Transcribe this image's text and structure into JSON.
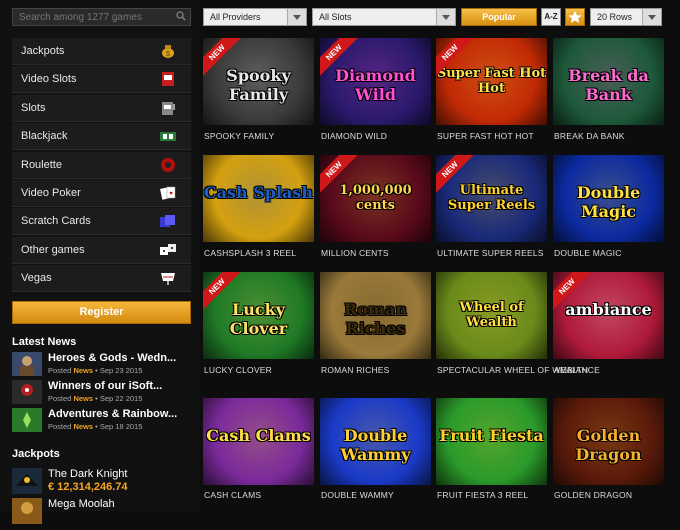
{
  "search": {
    "placeholder": "Search among 1277 games"
  },
  "sidebar": {
    "categories": [
      {
        "label": "Jackpots",
        "icon": "money-bag-icon"
      },
      {
        "label": "Video Slots",
        "icon": "video-slot-machine-icon"
      },
      {
        "label": "Slots",
        "icon": "slot-machine-icon"
      },
      {
        "label": "Blackjack",
        "icon": "blackjack-table-icon"
      },
      {
        "label": "Roulette",
        "icon": "roulette-wheel-icon"
      },
      {
        "label": "Video Poker",
        "icon": "playing-cards-icon"
      },
      {
        "label": "Scratch Cards",
        "icon": "scratch-cards-icon"
      },
      {
        "label": "Other games",
        "icon": "dice-icon"
      },
      {
        "label": "Vegas",
        "icon": "vegas-sign-icon"
      }
    ],
    "register_label": "Register",
    "latest_news_title": "Latest News",
    "news": [
      {
        "title": "Heroes & Gods - Wedn...",
        "posted": "Posted",
        "tag": "News",
        "date": "• Sep 23 2015"
      },
      {
        "title": "Winners of our iSoft...",
        "posted": "Posted",
        "tag": "News",
        "date": "• Sep 22 2015"
      },
      {
        "title": "Adventures & Rainbow...",
        "posted": "Posted",
        "tag": "News",
        "date": "• Sep 18 2015"
      }
    ],
    "jackpots_title": "Jackpots",
    "jackpots": [
      {
        "name": "The Dark Knight",
        "amount": "€ 12,314,246.74"
      },
      {
        "name": "Mega Moolah",
        "amount": ""
      }
    ]
  },
  "filters": {
    "providers": "All Providers",
    "type": "All Slots",
    "popular": "Popular",
    "az": "A-Z",
    "rows": "20 Rows"
  },
  "colors": {
    "accent": "#f0a020",
    "new_ribbon": "#d01818",
    "background": "#0d0d0d"
  },
  "new_label": "NEW",
  "games": [
    {
      "name": "SPOOKY FAMILY",
      "logo": "Spooky Family",
      "new": true,
      "bg": "#3a3a3a",
      "fg": "#e8e8e8"
    },
    {
      "name": "DIAMOND WILD",
      "logo": "Diamond Wild",
      "new": true,
      "bg": "#2b1a6e",
      "fg": "#ff4fd8"
    },
    {
      "name": "SUPER FAST HOT HOT",
      "logo": "Super Fast Hot Hot",
      "new": true,
      "bg": "#c22a05",
      "fg": "#ffe14a"
    },
    {
      "name": "BREAK DA BANK",
      "logo": "Break da Bank",
      "new": false,
      "bg": "#1d5a3a",
      "fg": "#ff6ad0"
    },
    {
      "name": "CASHSPLASH 3 REEL",
      "logo": "Cash Splash",
      "new": false,
      "bg": "#d4a010",
      "fg": "#1a5fc8"
    },
    {
      "name": "MILLION CENTS",
      "logo": "1,000,000 cents",
      "new": true,
      "bg": "#5a0a1a",
      "fg": "#ffd54a"
    },
    {
      "name": "ULTIMATE SUPER REELS",
      "logo": "Ultimate Super Reels",
      "new": true,
      "bg": "#1a2a7a",
      "fg": "#ffd230"
    },
    {
      "name": "DOUBLE MAGIC",
      "logo": "Double Magic",
      "new": false,
      "bg": "#0b2aa0",
      "fg": "#ffe040"
    },
    {
      "name": "LUCKY CLOVER",
      "logo": "Lucky Clover",
      "new": true,
      "bg": "#1f7a26",
      "fg": "#ffe066"
    },
    {
      "name": "ROMAN RICHES",
      "logo": "Roman Riches",
      "new": false,
      "bg": "#9a7a3a",
      "fg": "#3a2a10"
    },
    {
      "name": "SPECTACULAR WHEEL OF WEALTH",
      "logo": "Wheel of Wealth",
      "new": false,
      "bg": "#6a8a1a",
      "fg": "#ffe040"
    },
    {
      "name": "AMBIANCE",
      "logo": "ambiance",
      "new": true,
      "bg": "#b01a3a",
      "fg": "#ffffff"
    },
    {
      "name": "CASH CLAMS",
      "logo": "Cash Clams",
      "new": false,
      "bg": "#7a2a9a",
      "fg": "#ffe040"
    },
    {
      "name": "DOUBLE WAMMY",
      "logo": "Double Wammy",
      "new": false,
      "bg": "#1a3ac8",
      "fg": "#ffd030"
    },
    {
      "name": "FRUIT FIESTA 3 REEL",
      "logo": "Fruit Fiesta",
      "new": false,
      "bg": "#2a9a2a",
      "fg": "#ffd030"
    },
    {
      "name": "GOLDEN DRAGON",
      "logo": "Golden Dragon",
      "new": false,
      "bg": "#5a1a0a",
      "fg": "#f5b030"
    }
  ]
}
